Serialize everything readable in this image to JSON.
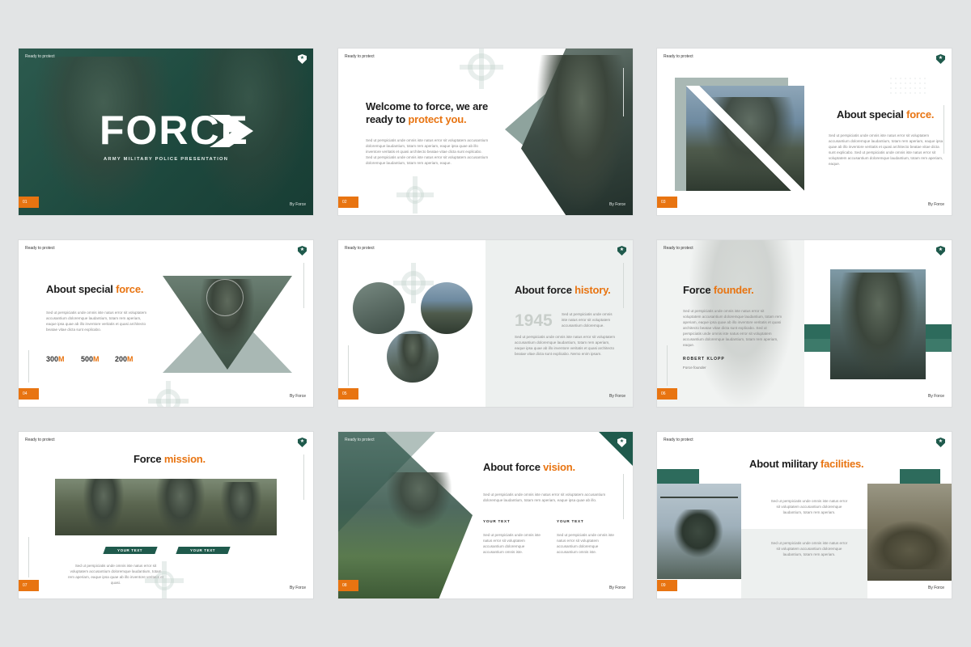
{
  "common": {
    "ready": "Ready to protect",
    "by_force": "By Force"
  },
  "slide1": {
    "num": "01",
    "title": "FORCE",
    "subtitle": "ARMY MILITARY POLICE PRESENTATION"
  },
  "slide2": {
    "num": "02",
    "title_line1": "Welcome to force, we are",
    "title_line2_a": "ready to ",
    "title_line2_b": "protect you.",
    "body": "Sed ut perspiciatis unde omnis iste natus error sit voluptatem accusantium doloremque laudantium, totam rem aperiam, eaque ipsa quae ab illo inventore veritatis et quasi architecto beatae vitae dicta sunt explicabo. Sed ut perspiciatis unde omnis iste natus error sit voluptatem accusantium doloremque laudantium, totam rem aperiam, eaque."
  },
  "slide3": {
    "num": "03",
    "title_a": "About special ",
    "title_b": "force.",
    "body": "Sed ut perspiciatis unde omnis iste natus error sit voluptatem accusantium doloremque laudantium, totam rem aperiam, eaque ipsa quae ab illo inventore veritatis et quasi architecto beatae vitae dicta sunt explicabo. Sed ut perspiciatis unde omnis iste natus error sit voluptatem accusantium doloremque laudantium, totam rem aperiam, eaque."
  },
  "slide4": {
    "num": "04",
    "title_a": "About special ",
    "title_b": "force.",
    "body": "Sed ut perspiciatis unde omnis iste natus error sit voluptatem accusantium doloremque laudantium, totam rem aperiam, eaque ipsa quae ab illo inventore veritatis et quasi architecto beatae vitae dicta sunt explicabo.",
    "stats": [
      {
        "value": "300",
        "unit": "M"
      },
      {
        "value": "500",
        "unit": "M"
      },
      {
        "value": "200",
        "unit": "M"
      }
    ]
  },
  "slide5": {
    "num": "05",
    "title_a": "About force ",
    "title_b": "history.",
    "year": "1945",
    "body_top": "Sed ut perspiciatis unde omnis iste natus error sit voluptatem accusantium doloremque.",
    "body_bottom": "Sed ut perspiciatis unde omnis iste natus error sit voluptatem accusantium doloremque laudantium, totam rem aperiam, eaque ipsa quae ab illo inventore veritatis et quasi architecto beatae vitae dicta sunt explicabo. Nemo enim ipsam."
  },
  "slide6": {
    "num": "06",
    "title_a": "Force ",
    "title_b": "founder.",
    "body": "Sed ut perspiciatis unde omnis iste natus error sit voluptatem accusantium doloremque laudantium, totam rem aperiam, eaque ipsa quae ab illo inventore veritatis et quasi architecto beatae vitae dicta sunt explicabo. Sed ut perspiciatis unde omnis iste natus error sit voluptatem accusantium doloremque laudantium, totam rem aperiam, eaque.",
    "name": "ROBERT KLOPP",
    "role": "Force founder"
  },
  "slide7": {
    "num": "07",
    "title_a": "Force ",
    "title_b": "mission.",
    "pill1": "YOUR TEXT",
    "pill2": "YOUR TEXT",
    "body": "Sed ut perspiciatis unde omnis iste natus error sit voluptatem accusantium doloremque laudantium, totam rem aperiam, eaque ipsa quae ab illo inventore veritatis et quasi."
  },
  "slide8": {
    "num": "08",
    "title_a": "About force ",
    "title_b": "vision.",
    "body": "Sed ut perspiciatis unde omnis iste natus error sit voluptatem accusantium doloremque laudantium, totam rem aperiam, eaque ipsa quae ab illo.",
    "col1_head": "YOUR TEXT",
    "col2_head": "YOUR TEXT",
    "col1_body": "Sed ut perspiciatis unde omnis iste natus error sit voluptatem accusantium doloremque accusantium omnis iste.",
    "col2_body": "Sed ut perspiciatis unde omnis iste natus error sit voluptatem accusantium doloremque accusantium omnis iste."
  },
  "slide9": {
    "num": "09",
    "title_a": "About military ",
    "title_b": "facilities.",
    "body_top": "Sed ut perspiciatis unde omnis iste natus error sit voluptatem accusantium doloremque laudantium, totam rem aperiam.",
    "body_bottom": "Sed ut perspiciatis unde omnis iste natus error sit voluptatem accusantium doloremque laudantium, totam rem aperiam."
  },
  "colors": {
    "accent": "#e87411",
    "brand_green": "#1f5a4c",
    "dark_green": "#1f4a40",
    "background": "#e2e4e5"
  }
}
